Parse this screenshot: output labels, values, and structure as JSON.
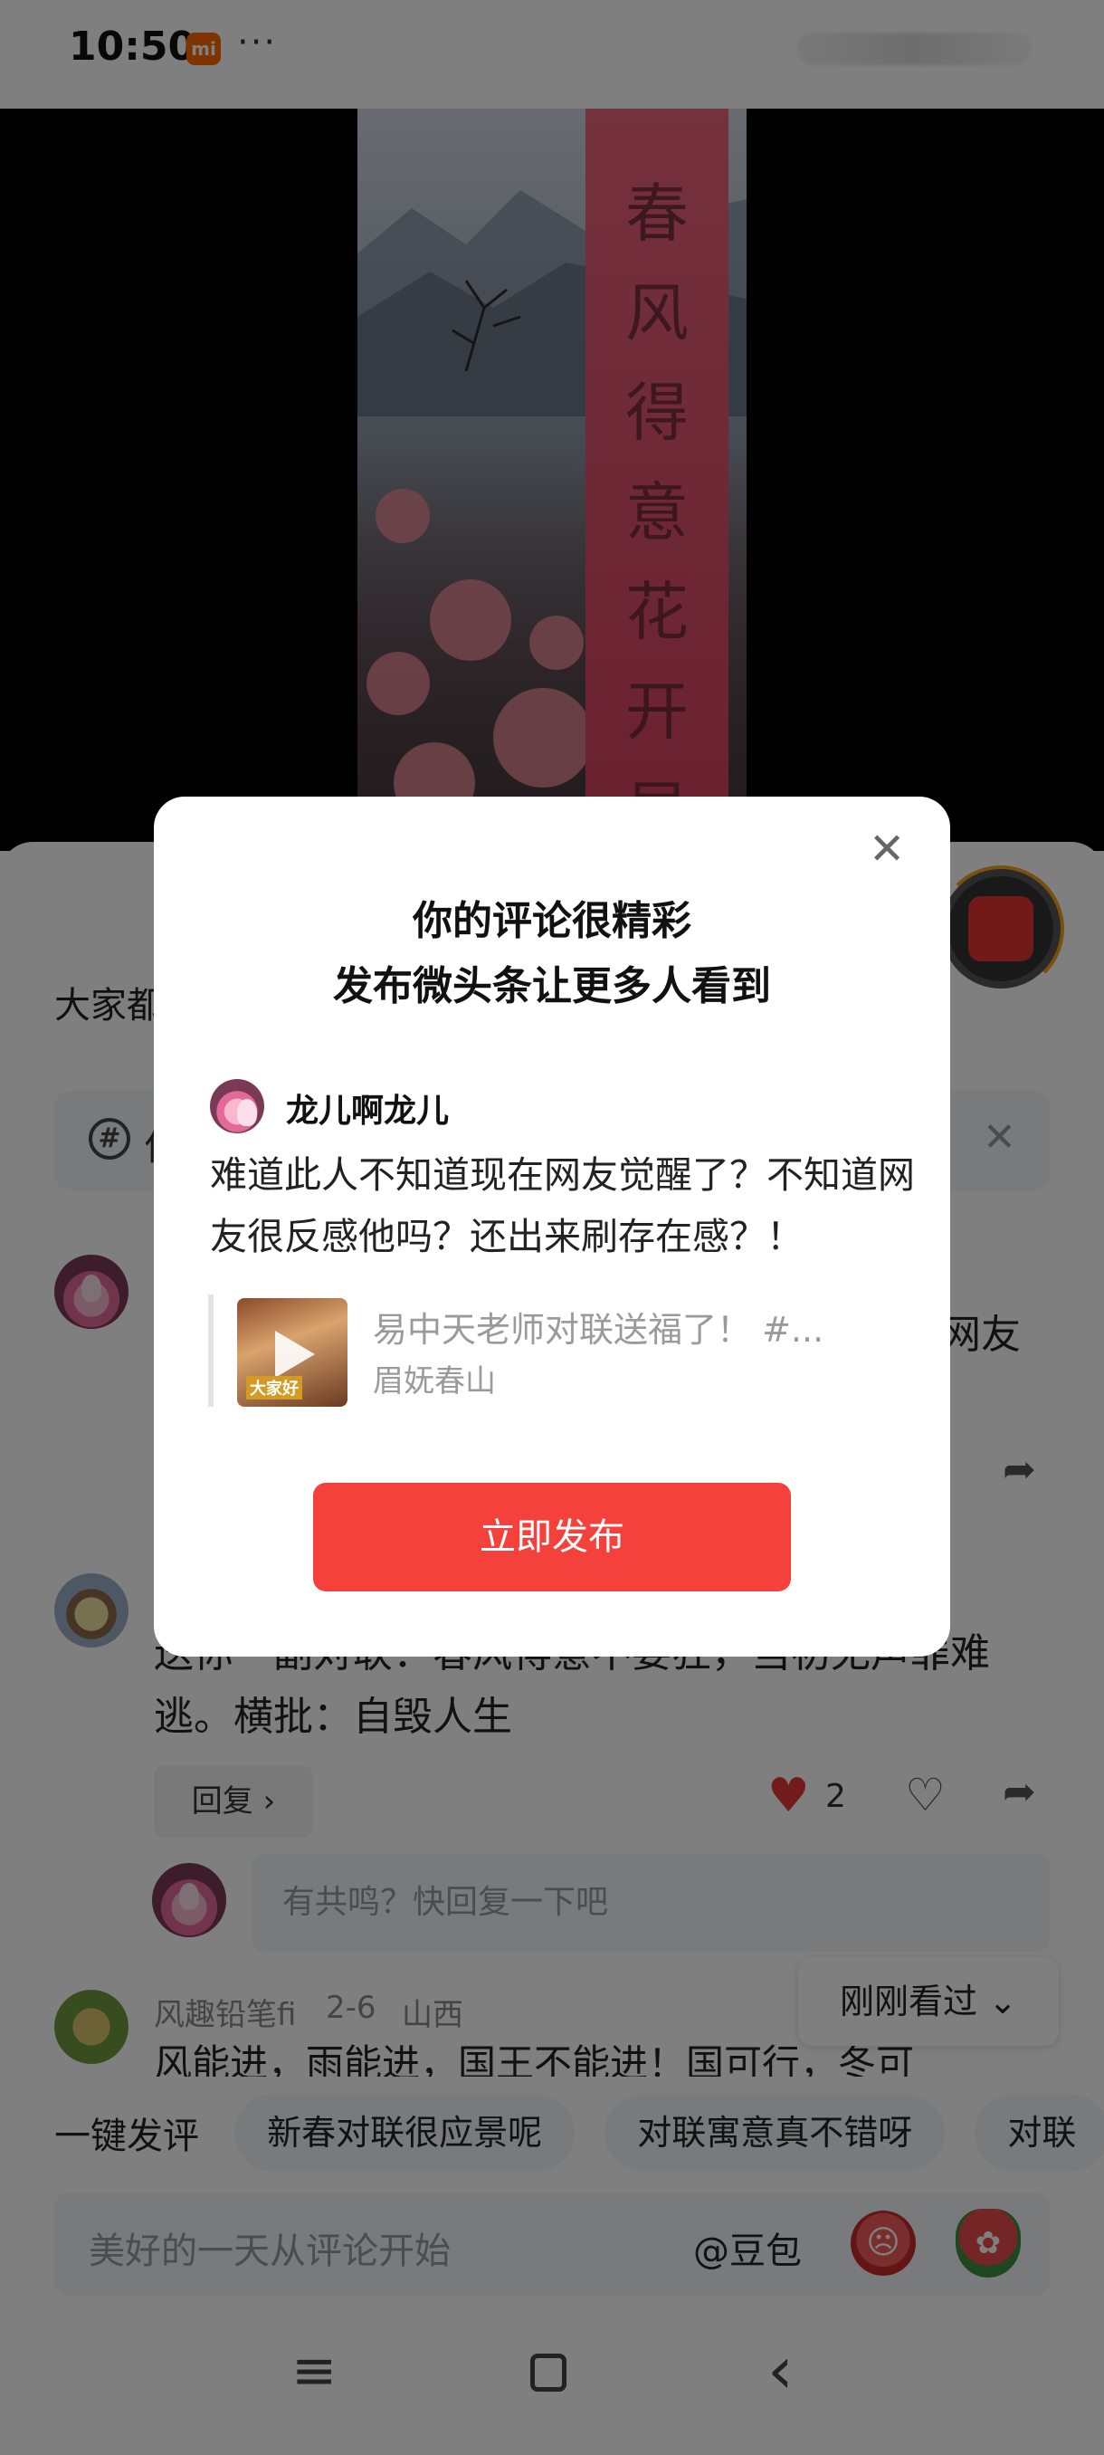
{
  "status_bar": {
    "time": "10:50",
    "mi_badge": "mi",
    "more_dots": "···"
  },
  "video": {
    "scroll_text": [
      "春",
      "风",
      "得",
      "意",
      "花",
      "开",
      "早"
    ]
  },
  "comments_sheet": {
    "intro_text": "大家都",
    "topic_bar": {
      "icon": "#",
      "letter": "你"
    },
    "comment1": {
      "tail": "网友"
    },
    "comment2": {
      "text": "送你一副对联：春风得意不要狂，当初无声罪难逃。横批：自毁人生",
      "reply_label": "回复 ›",
      "likes": "2"
    },
    "reply_input_placeholder": "有共鸣？快回复一下吧",
    "comment3": {
      "username": "风趣铅笔fi",
      "date": "2-6",
      "region": "山西",
      "text": "风能进，雨能进，国王不能进！国可行，冬可"
    },
    "recent_label": "刚刚看过 ⌄"
  },
  "quick_comments": {
    "label": "一键发评",
    "chips": [
      "新春对联很应景呢",
      "对联寓意真不错呀",
      "对联"
    ]
  },
  "comment_input": {
    "placeholder": "美好的一天从评论开始",
    "mention": "@豆包"
  },
  "nav": {
    "menu_icon": "≡",
    "back_icon": "‹"
  },
  "dialog": {
    "close_icon": "✕",
    "title": "你的评论很精彩",
    "subtitle": "发布微头条让更多人看到",
    "user_name": "龙儿啊龙儿",
    "comment_text": "难道此人不知道现在网友觉醒了？不知道网友很反感他吗？还出来刷存在感？！",
    "quoted_title": "易中天老师对联送福了！ #...",
    "quoted_author": "眉妩春山",
    "thumb_tag": "大家好",
    "publish_label": "立即发布"
  },
  "colors": {
    "accent_red": "#f5413b",
    "like_red": "#e5363b",
    "overlay": "rgba(0,0,0,0.5)"
  }
}
